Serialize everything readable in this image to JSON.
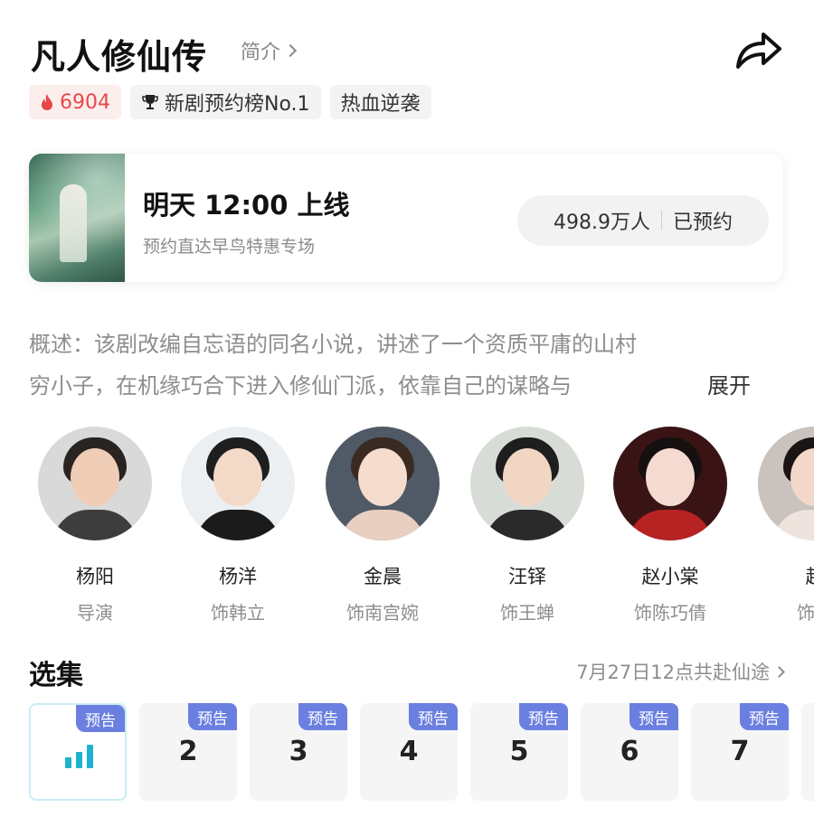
{
  "header": {
    "title": "凡人修仙传",
    "intro_label": "简介"
  },
  "tags": {
    "heat": "6904",
    "rank": "新剧预约榜No.1",
    "genre": "热血逆袭"
  },
  "release": {
    "time": "明天 12:00 上线",
    "subtitle": "预约直达早鸟特惠专场",
    "reserve_count": "498.9万人",
    "reserve_status": "已预约"
  },
  "overview": {
    "line1": "概述：该剧改编自忘语的同名小说，讲述了一个资质平庸的山村",
    "line2": "穷小子，在机缘巧合下进入修仙门派，依靠自己的谋略与",
    "expand_label": "展开"
  },
  "cast": [
    {
      "name": "杨阳",
      "role": "导演"
    },
    {
      "name": "杨洋",
      "role": "饰韩立"
    },
    {
      "name": "金晨",
      "role": "饰南宫婉"
    },
    {
      "name": "汪铎",
      "role": "饰王蝉"
    },
    {
      "name": "赵小棠",
      "role": "饰陈巧倩"
    },
    {
      "name": "赵",
      "role": "饰墨"
    }
  ],
  "episodes_section": {
    "title": "选集",
    "update_note": "7月27日12点共赴仙途"
  },
  "episodes": [
    {
      "label": "",
      "badge": "预告",
      "playing": true
    },
    {
      "label": "2",
      "badge": "预告"
    },
    {
      "label": "3",
      "badge": "预告"
    },
    {
      "label": "4",
      "badge": "预告"
    },
    {
      "label": "5",
      "badge": "预告"
    },
    {
      "label": "6",
      "badge": "预告"
    },
    {
      "label": "7",
      "badge": "预告"
    }
  ],
  "colors": {
    "heat": "#e8484a",
    "badge": "#6a7fe0",
    "playing": "#1fb2ce"
  }
}
